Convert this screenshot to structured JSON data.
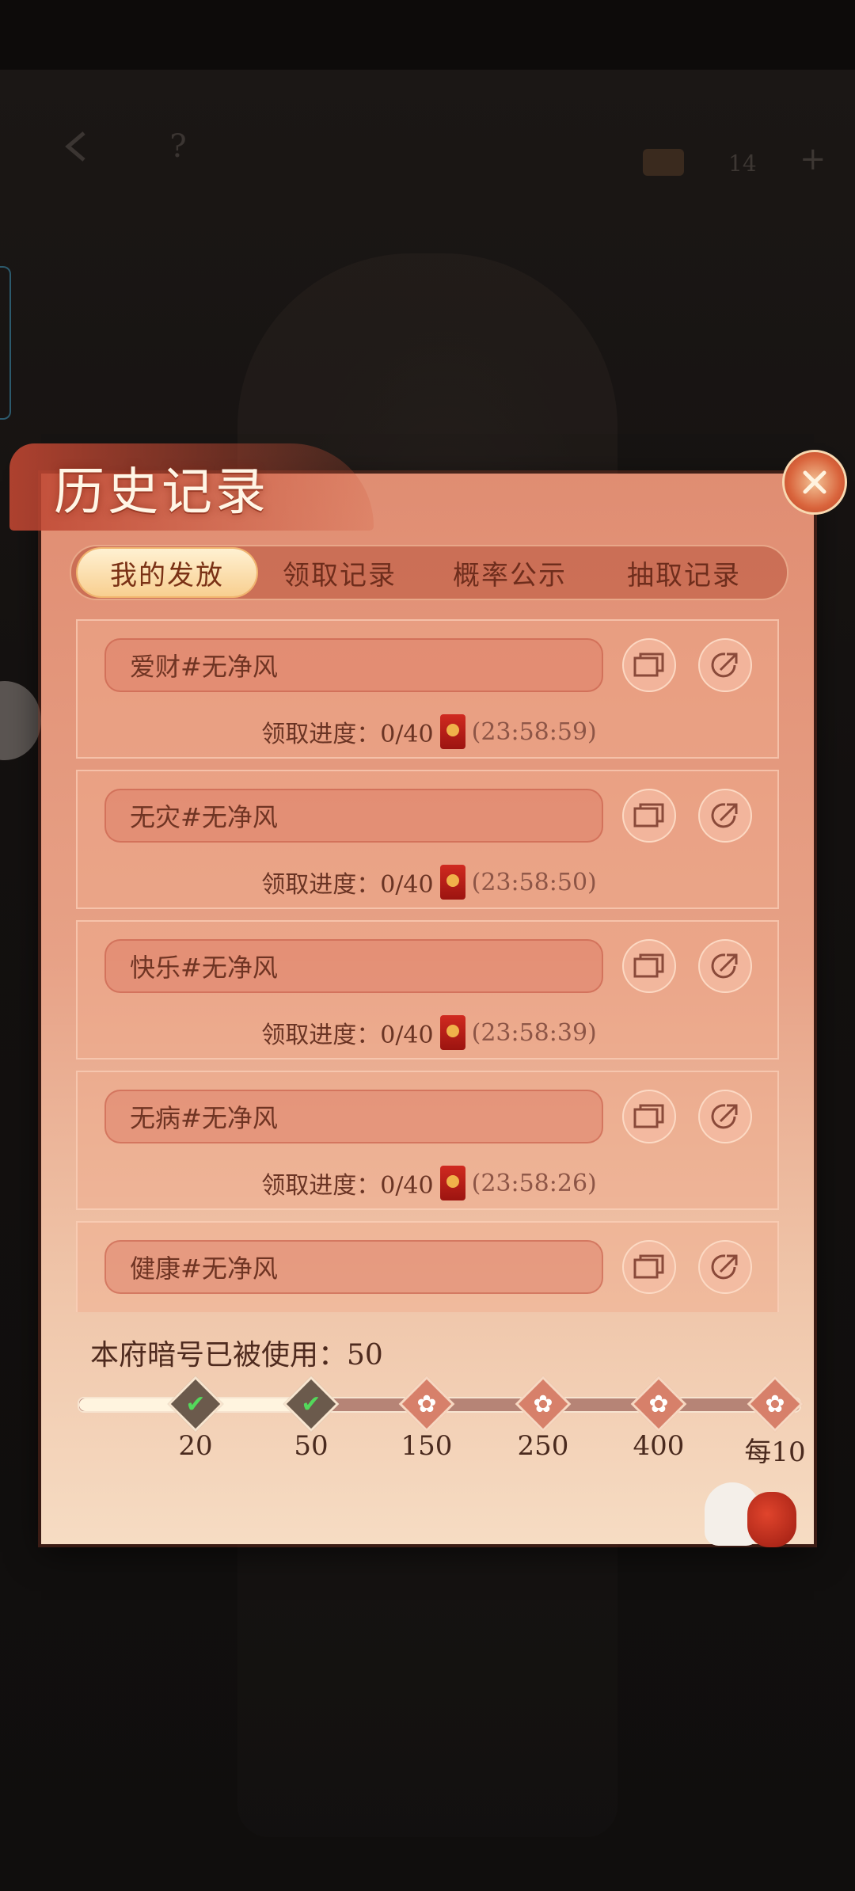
{
  "hud": {
    "back_icon": "back-arrow-icon",
    "help_label": "?",
    "resource_count": "14",
    "plus_label": "+"
  },
  "panel": {
    "title": "历史记录",
    "close_icon": "close-icon"
  },
  "tabs": [
    {
      "label": "我的发放",
      "active": true
    },
    {
      "label": "领取记录",
      "active": false
    },
    {
      "label": "概率公示",
      "active": false
    },
    {
      "label": "抽取记录",
      "active": false
    }
  ],
  "records": [
    {
      "code": "爱财#无净风",
      "progress_label": "领取进度：0/40",
      "timer": "(23:58:59)"
    },
    {
      "code": "无灾#无净风",
      "progress_label": "领取进度：0/40",
      "timer": "(23:58:50)"
    },
    {
      "code": "快乐#无净风",
      "progress_label": "领取进度：0/40",
      "timer": "(23:58:39)"
    },
    {
      "code": "无病#无净风",
      "progress_label": "领取进度：0/40",
      "timer": "(23:58:26)"
    },
    {
      "code": "健康#无净风",
      "progress_label": "",
      "timer": ""
    }
  ],
  "milestones": {
    "used_label": "本府暗号已被使用：50",
    "progress_fraction": 0.31,
    "nodes": [
      {
        "label": "20",
        "completed": true
      },
      {
        "label": "50",
        "completed": true
      },
      {
        "label": "150",
        "completed": false
      },
      {
        "label": "250",
        "completed": false
      },
      {
        "label": "400",
        "completed": false
      },
      {
        "label": "每10",
        "completed": false
      }
    ]
  },
  "colors": {
    "panel_top": "#e08d72",
    "panel_bottom": "#f6dcc3",
    "tab_active": "#f8cf90",
    "text_dark": "#6e2d1c"
  }
}
